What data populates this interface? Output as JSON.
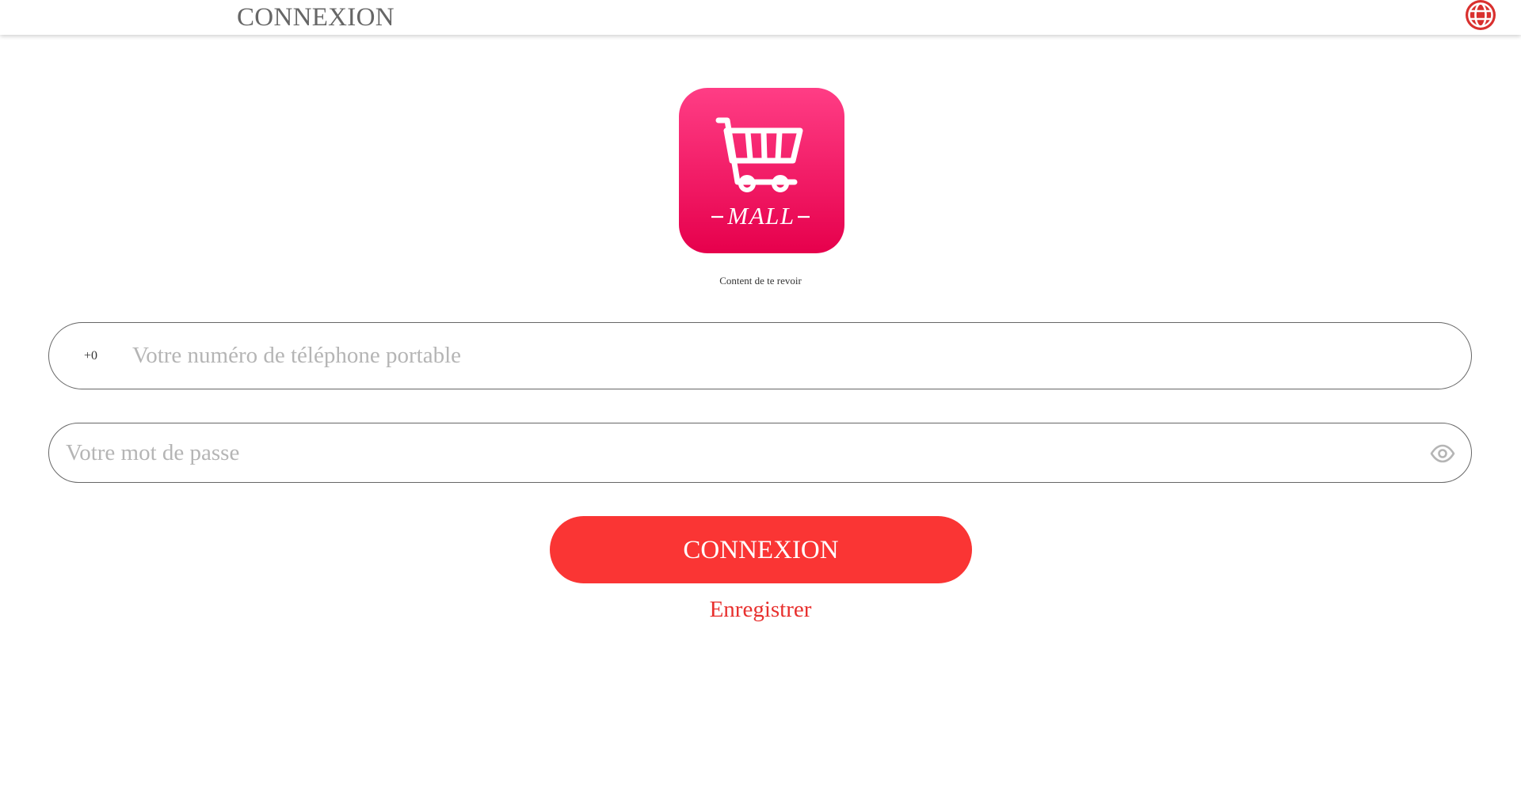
{
  "header": {
    "title": "CONNEXION",
    "language_icon": "globe-icon"
  },
  "logo": {
    "text": "MALL",
    "icon": "shopping-cart-icon",
    "gradient_top": "#ff3d85",
    "gradient_bottom": "#e6004c"
  },
  "greeting": "Content de te revoir",
  "phone_field": {
    "prefix": "+0",
    "value": "",
    "placeholder": "Votre numéro de téléphone portable"
  },
  "password_field": {
    "value": "",
    "placeholder": "Votre mot de passe",
    "toggle_icon": "eye-icon"
  },
  "submit_label": "CONNEXION",
  "register_label": "Enregistrer",
  "colors": {
    "accent": "#fa3534",
    "link": "#e8302e",
    "globe": "#d9302e",
    "placeholder": "#b5b5b5"
  }
}
